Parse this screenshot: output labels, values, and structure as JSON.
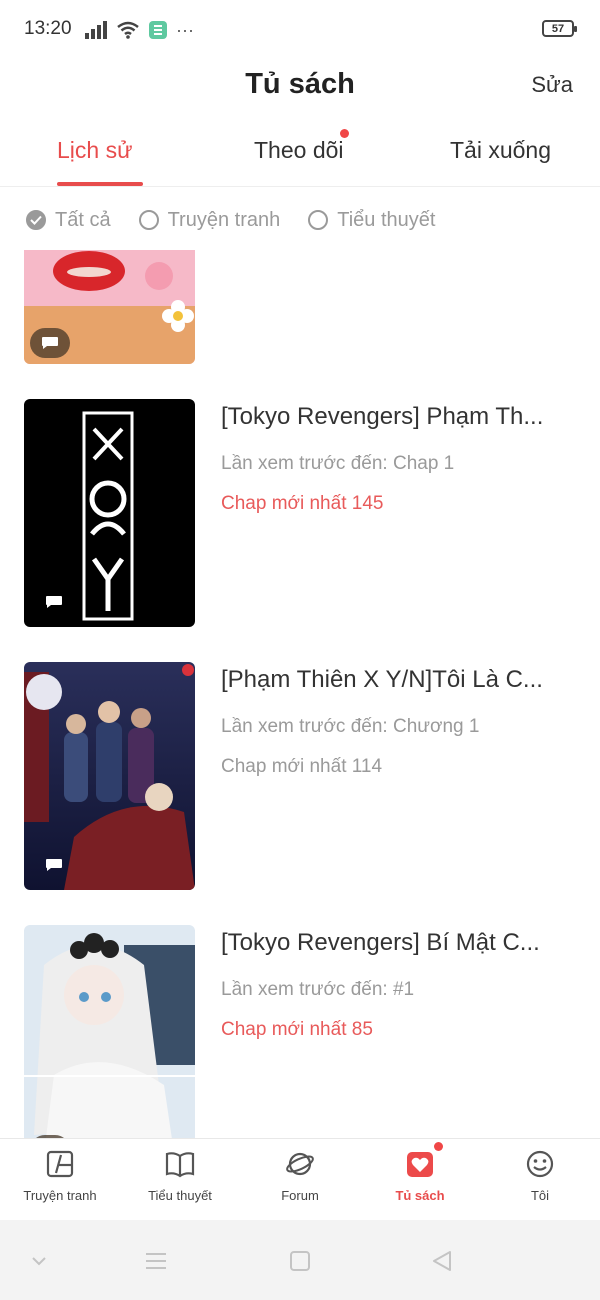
{
  "status_bar": {
    "time": "13:20",
    "battery": "57",
    "more": "···"
  },
  "header": {
    "title": "Tủ sách",
    "edit_label": "Sửa"
  },
  "tabs": [
    {
      "label": "Lịch sử",
      "active": true,
      "has_dot": false
    },
    {
      "label": "Theo dõi",
      "active": false,
      "has_dot": true
    },
    {
      "label": "Tải xuống",
      "active": false,
      "has_dot": false
    }
  ],
  "filters": [
    {
      "label": "Tất cả",
      "checked": true
    },
    {
      "label": "Truyện tranh",
      "checked": false
    },
    {
      "label": "Tiểu thuyết",
      "checked": false
    }
  ],
  "items": [
    {
      "title": "",
      "progress": "",
      "latest": ""
    },
    {
      "title": "[Tokyo Revengers] Phạm Th...",
      "progress": "Lần xem trước đến: Chap 1",
      "latest": "Chap mới nhất 145",
      "latest_highlight": true
    },
    {
      "title": "[Phạm Thiên X Y/N]Tôi Là C...",
      "progress": "Lần xem trước đến: Chương 1",
      "latest": "Chap mới nhất 114",
      "latest_highlight": false
    },
    {
      "title": "[Tokyo Revengers] Bí Mật C...",
      "progress": "Lần xem trước đến: #1",
      "latest": "Chap mới nhất 85",
      "latest_highlight": true
    }
  ],
  "bottom_nav": [
    {
      "label": "Truyện tranh",
      "icon": "comic-book-icon",
      "active": false
    },
    {
      "label": "Tiểu thuyết",
      "icon": "open-book-icon",
      "active": false
    },
    {
      "label": "Forum",
      "icon": "planet-icon",
      "active": false
    },
    {
      "label": "Tủ sách",
      "icon": "bookshelf-heart-icon",
      "active": true,
      "has_dot": true
    },
    {
      "label": "Tôi",
      "icon": "smiley-face-icon",
      "active": false
    }
  ],
  "colors": {
    "accent": "#e84c4c",
    "muted": "#9a9a9a",
    "text": "#333333"
  }
}
